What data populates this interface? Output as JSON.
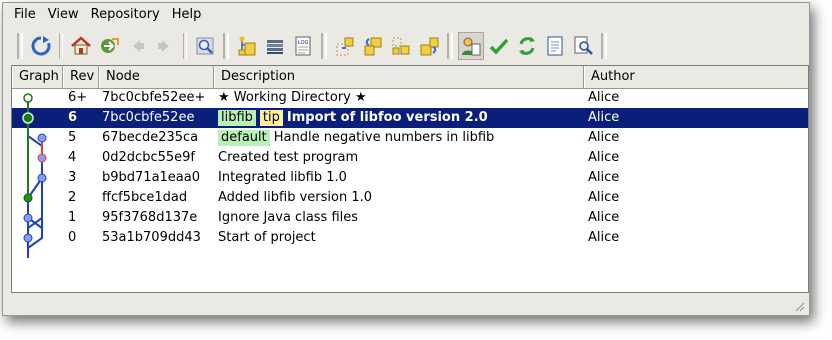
{
  "menu": [
    "File",
    "View",
    "Repository",
    "Help"
  ],
  "toolbar": {
    "groups": [
      [
        {
          "icon": "refresh-icon"
        }
      ],
      [
        {
          "icon": "home-icon"
        },
        {
          "icon": "goto-icon"
        },
        {
          "icon": "back-arrow-icon"
        },
        {
          "icon": "forward-arrow-icon"
        }
      ],
      [
        {
          "icon": "search-icon"
        }
      ],
      [
        {
          "icon": "branch-graph-icon"
        },
        {
          "icon": "stack-icon"
        },
        {
          "icon": "log-icon"
        }
      ],
      [
        {
          "icon": "incoming-icon"
        },
        {
          "icon": "pull-icon"
        },
        {
          "icon": "outgoing-icon"
        },
        {
          "icon": "push-icon"
        }
      ],
      [
        {
          "icon": "user-filter-icon"
        },
        {
          "icon": "checkmark-icon"
        },
        {
          "icon": "sync-arrows-icon"
        },
        {
          "icon": "document-icon"
        },
        {
          "icon": "document-search-icon"
        }
      ]
    ]
  },
  "columns": {
    "graph": "Graph",
    "rev": "Rev",
    "node": "Node",
    "description": "Description",
    "author": "Author"
  },
  "rows": [
    {
      "rev": "6+",
      "node": "7bc0cbfe52ee+",
      "description": "★ Working Directory ★",
      "author": "Alice",
      "tags": [],
      "selected": false
    },
    {
      "rev": "6",
      "node": "7bc0cbfe52ee",
      "description": "Import of libfoo version 2.0",
      "author": "Alice",
      "tags": [
        "libfib",
        "tip"
      ],
      "selected": true
    },
    {
      "rev": "5",
      "node": "67becde235ca",
      "description": "Handle negative numbers in libfib",
      "author": "Alice",
      "tags": [
        "default"
      ],
      "selected": false
    },
    {
      "rev": "4",
      "node": "0d2dcbc55e9f",
      "description": "Created test program",
      "author": "Alice",
      "tags": [],
      "selected": false
    },
    {
      "rev": "3",
      "node": "b9bd71a1eaa0",
      "description": "Integrated libfib 1.0",
      "author": "Alice",
      "tags": [],
      "selected": false
    },
    {
      "rev": "2",
      "node": "ffcf5bce1dad",
      "description": "Added libfib version 1.0",
      "author": "Alice",
      "tags": [],
      "selected": false
    },
    {
      "rev": "1",
      "node": "95f3768d137e",
      "description": "Ignore Java class files",
      "author": "Alice",
      "tags": [],
      "selected": false
    },
    {
      "rev": "0",
      "node": "53a1b709dd43",
      "description": "Start of project",
      "author": "Alice",
      "tags": [],
      "selected": false
    }
  ],
  "colors": {
    "selection": "#0a1f7a",
    "branch_green": "#1a7a1a",
    "branch_blue": "#2040c0",
    "node_blue": "#8a9cf0",
    "node_red": "#e04040"
  }
}
